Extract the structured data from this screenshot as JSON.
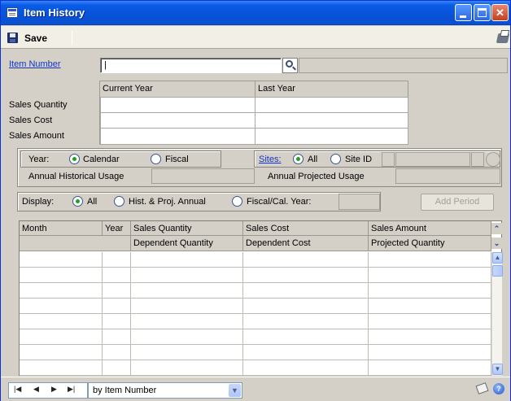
{
  "window": {
    "title": "Item History"
  },
  "toolbar": {
    "save_label": "Save"
  },
  "item": {
    "label": "Item Number",
    "value": "|"
  },
  "sales_table": {
    "columns": [
      "Current Year",
      "Last Year"
    ],
    "rows": [
      "Sales Quantity",
      "Sales Cost",
      "Sales Amount"
    ]
  },
  "options": {
    "year_label": "Year:",
    "calendar": "Calendar",
    "fiscal": "Fiscal",
    "annual_historical": "Annual Historical Usage",
    "sites_label": "Sites:",
    "all": "All",
    "site_id": "Site ID",
    "annual_projected": "Annual Projected Usage",
    "year_selected": "Calendar",
    "sites_selected": "All"
  },
  "display": {
    "label": "Display:",
    "all": "All",
    "hist_proj": "Hist. & Proj. Annual",
    "fiscal_cal": "Fiscal/Cal. Year:",
    "selected": "All",
    "add_period": "Add Period"
  },
  "grid": {
    "headers_row1": [
      "Month",
      "Year",
      "Sales Quantity",
      "Sales Cost",
      "Sales Amount"
    ],
    "headers_row2": [
      "Dependent Quantity",
      "Dependent Cost",
      "Projected Quantity"
    ]
  },
  "bottom": {
    "sort_by": "by Item Number"
  }
}
